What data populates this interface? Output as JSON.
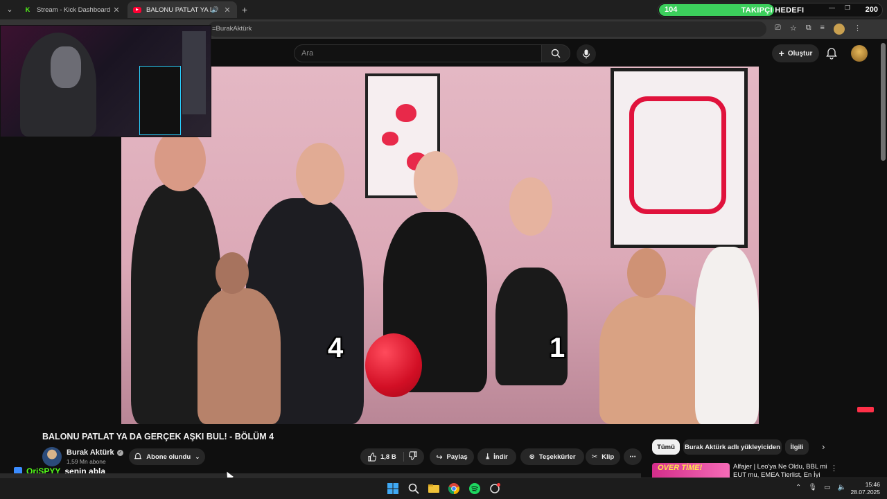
{
  "browser": {
    "tabs": [
      {
        "label": "Stream - Kick Dashboard",
        "active": false
      },
      {
        "label": "BALONU PATLAT YA DA GERÇEK AŞKI BUL! - BÖLÜM 4",
        "active": true
      }
    ],
    "url": "=BurakAktürk"
  },
  "follower_goal": {
    "current": "104",
    "title": "TAKIPÇI HEDEFI",
    "target": "200",
    "progress_fraction": 0.52,
    "fill_color": "#3ccf5c"
  },
  "youtube": {
    "search_placeholder": "Ara",
    "create_label": "Oluştur"
  },
  "video": {
    "overlay_numbers": [
      "4",
      "1"
    ],
    "title": "BALONU PATLAT YA DA GERÇEK AŞKI BUL! - BÖLÜM 4",
    "channel": {
      "name": "Burak Aktürk",
      "subscribers": "1,59 Mn abone"
    },
    "actions": {
      "subscribed_label": "Abone olundu",
      "likes": "1,8 B",
      "share_label": "Paylaş",
      "download_label": "İndir",
      "thanks_label": "Teşekkürler",
      "clip_label": "Klip"
    }
  },
  "sidebar": {
    "chips": [
      "Tümü",
      "Burak Aktürk adlı yükleyiciden",
      "İlgili"
    ],
    "recommendation": {
      "thumb_text": "OVER TİME!",
      "title": "Alfajer | Leo'ya Ne Oldu, BBL mi EUT mu, EMEA Tierlist, En İyi"
    }
  },
  "chat": {
    "user": "QriSPYY",
    "message": "senin abla"
  },
  "taskbar": {
    "time": "15:46",
    "date": "28.07.2025"
  }
}
